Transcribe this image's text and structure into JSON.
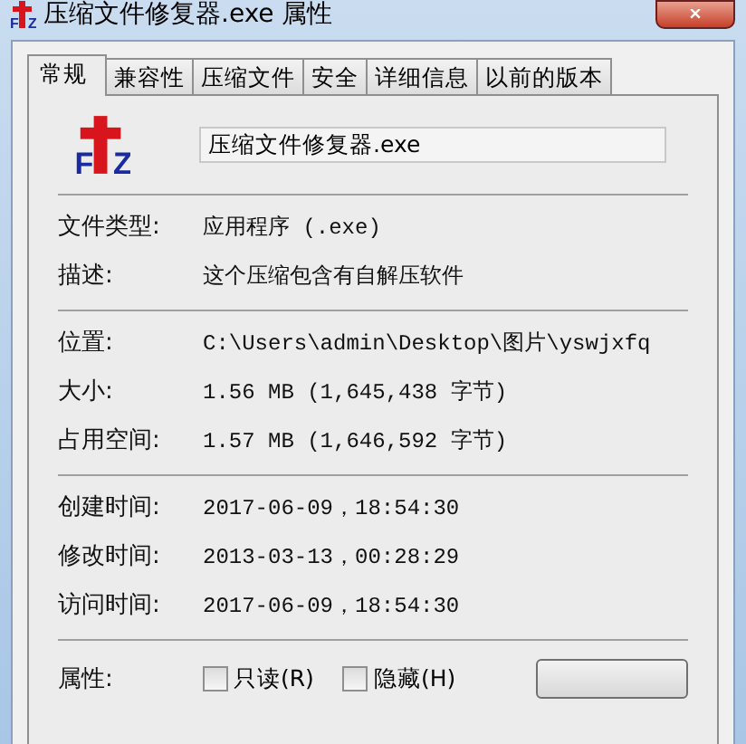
{
  "window": {
    "title": "压缩文件修复器.exe 属性",
    "icon_letters": [
      "F",
      "Z"
    ]
  },
  "tabs": [
    {
      "label": "常规",
      "selected": true
    },
    {
      "label": "兼容性",
      "selected": false
    },
    {
      "label": "压缩文件",
      "selected": false
    },
    {
      "label": "安全",
      "selected": false
    },
    {
      "label": "详细信息",
      "selected": false
    },
    {
      "label": "以前的版本",
      "selected": false
    }
  ],
  "file": {
    "icon_letters": [
      "F",
      "Z"
    ],
    "name": "压缩文件修复器.exe"
  },
  "sections": [
    [
      {
        "label": "文件类型:",
        "value": "应用程序 (.exe)"
      },
      {
        "label": "描述:",
        "value": "这个压缩包含有自解压软件"
      }
    ],
    [
      {
        "label": "位置:",
        "value": "C:\\Users\\admin\\Desktop\\图片\\yswjxfq"
      },
      {
        "label": "大小:",
        "value": "1.56 MB (1,645,438 字节)"
      },
      {
        "label": "占用空间:",
        "value": "1.57 MB (1,646,592 字节)"
      }
    ],
    [
      {
        "label": "创建时间:",
        "value": "2017-06-09，18:54:30"
      },
      {
        "label": "修改时间:",
        "value": "2013-03-13，00:28:29"
      },
      {
        "label": "访问时间:",
        "value": "2017-06-09，18:54:30"
      }
    ]
  ],
  "attributes": {
    "label": "属性:",
    "options": [
      {
        "label": "只读(R)",
        "checked": false
      },
      {
        "label": "隐藏(H)",
        "checked": false
      }
    ]
  }
}
